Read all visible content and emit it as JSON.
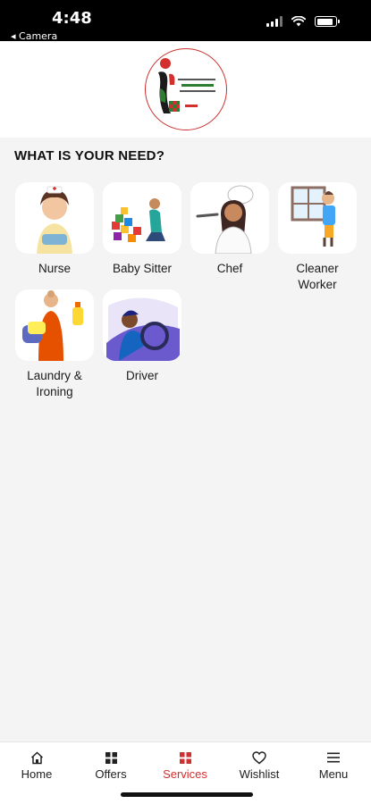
{
  "status": {
    "time": "4:48",
    "back_app": "◂ Camera",
    "battery_level": 0.85
  },
  "page": {
    "title": "WHAT IS YOUR NEED?"
  },
  "services": [
    {
      "label": "Nurse",
      "icon": "nurse-illustration"
    },
    {
      "label": "Baby Sitter",
      "icon": "baby-sitter-illustration"
    },
    {
      "label": "Chef",
      "icon": "chef-illustration"
    },
    {
      "label": "Cleaner Worker",
      "icon": "cleaner-illustration"
    },
    {
      "label": "Laundry & Ironing",
      "icon": "laundry-illustration"
    },
    {
      "label": "Driver",
      "icon": "driver-illustration"
    }
  ],
  "tabs": [
    {
      "label": "Home",
      "icon": "home-icon"
    },
    {
      "label": "Offers",
      "icon": "grid-icon"
    },
    {
      "label": "Services",
      "icon": "grid-icon",
      "active": true
    },
    {
      "label": "Wishlist",
      "icon": "heart-icon"
    },
    {
      "label": "Menu",
      "icon": "menu-icon"
    }
  ],
  "colors": {
    "accent": "#d32f2f",
    "background": "#f4f4f4",
    "tile": "#ffffff"
  }
}
